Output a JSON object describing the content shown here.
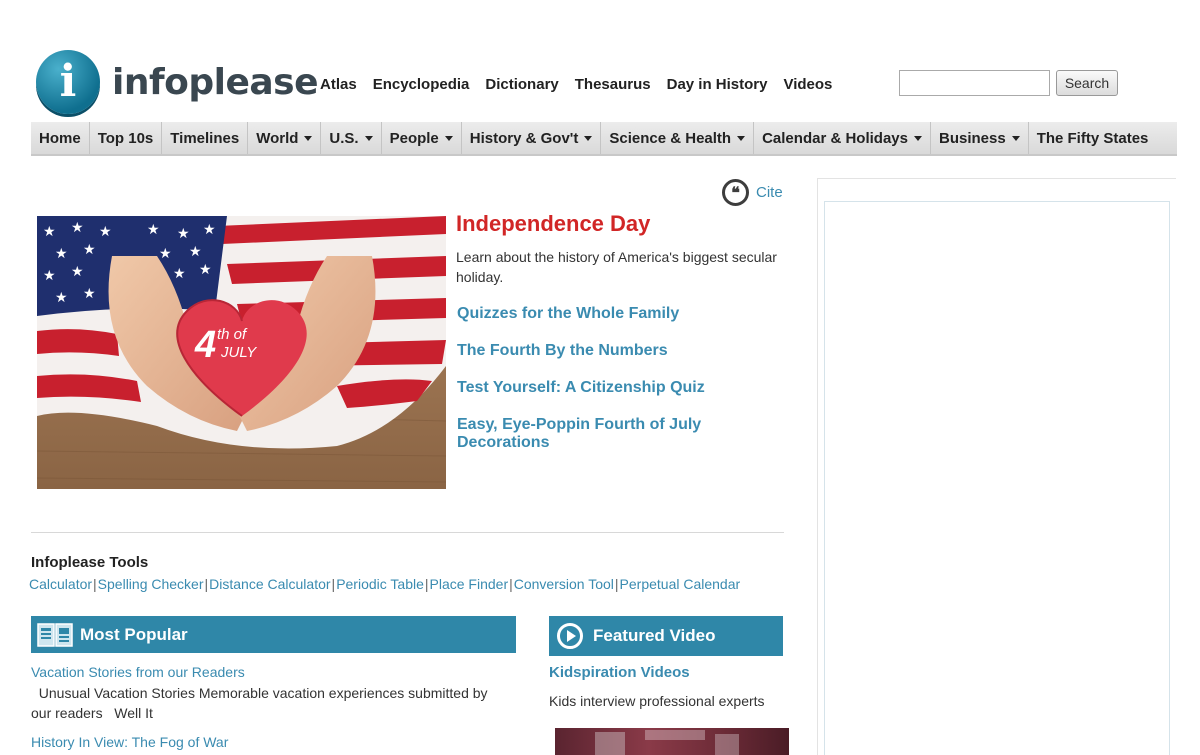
{
  "brand": {
    "name": "infoplease",
    "logo_glyph": "i"
  },
  "topnav": [
    "Atlas",
    "Encyclopedia",
    "Dictionary",
    "Thesaurus",
    "Day in History",
    "Videos"
  ],
  "search": {
    "placeholder": "",
    "button_label": "Search"
  },
  "mainnav": [
    {
      "label": "Home",
      "dropdown": false
    },
    {
      "label": "Top 10s",
      "dropdown": false
    },
    {
      "label": "Timelines",
      "dropdown": false
    },
    {
      "label": "World",
      "dropdown": true
    },
    {
      "label": "U.S.",
      "dropdown": true
    },
    {
      "label": "People",
      "dropdown": true
    },
    {
      "label": "History & Gov't",
      "dropdown": true
    },
    {
      "label": "Science & Health",
      "dropdown": true
    },
    {
      "label": "Calendar & Holidays",
      "dropdown": true
    },
    {
      "label": "Business",
      "dropdown": true
    },
    {
      "label": "The Fifty States",
      "dropdown": false
    }
  ],
  "cite": {
    "label": "Cite",
    "icon": "quote-icon"
  },
  "feature": {
    "image_text_top": "th of",
    "image_text_num": "4",
    "image_text_bottom": "JULY",
    "title": "Independence Day",
    "description": "Learn about the history of America's biggest secular holiday.",
    "links": [
      "Quizzes for the Whole Family",
      "The Fourth By the Numbers",
      "Test Yourself: A Citizenship Quiz",
      "Easy, Eye-Poppin Fourth of July Decorations"
    ]
  },
  "tools": {
    "title": "Infoplease Tools",
    "items": [
      "Calculator",
      "Spelling Checker",
      "Distance Calculator",
      "Periodic Table",
      "Place Finder",
      "Conversion Tool",
      "Perpetual Calendar"
    ]
  },
  "most_popular": {
    "title": "Most Popular",
    "items": [
      {
        "title": "Vacation Stories from our Readers",
        "description": "  Unusual Vacation Stories Memorable vacation experiences submitted by our readers   Well It"
      },
      {
        "title": "History In View: The Fog of War"
      }
    ]
  },
  "featured_video": {
    "title": "Featured Video",
    "video_title": "Kidspiration Videos",
    "video_description": "Kids interview professional experts"
  },
  "colors": {
    "accent": "#2f87a8",
    "link": "#3a8bb0",
    "headline": "#d12626"
  }
}
